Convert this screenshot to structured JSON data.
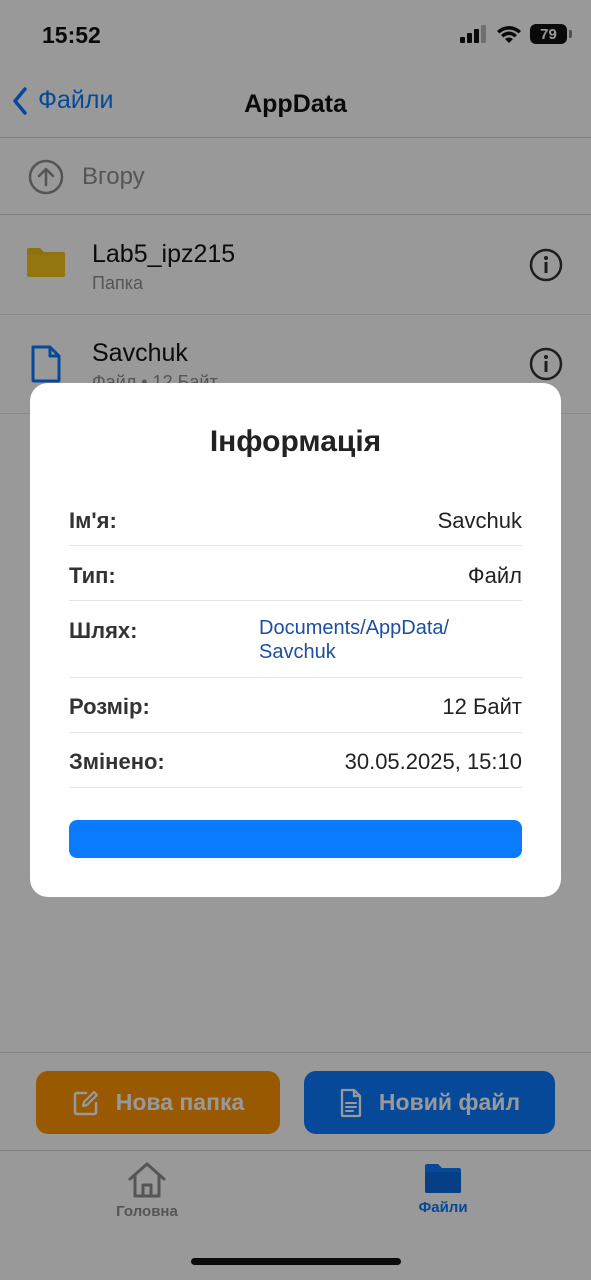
{
  "status": {
    "time": "15:52",
    "battery": "79"
  },
  "nav": {
    "back_label": "Файли",
    "title": "AppData"
  },
  "up_row": {
    "label": "Вгору"
  },
  "files": [
    {
      "name": "Lab5_ipz215",
      "subtitle": "Папка",
      "icon": "folder-icon"
    },
    {
      "name": "Savchuk",
      "subtitle": "Файл • 12 Байт",
      "icon": "document-icon"
    }
  ],
  "actions": {
    "new_folder": "Нова папка",
    "new_file": "Новий файл"
  },
  "tabs": {
    "home": "Головна",
    "files": "Файли"
  },
  "colors": {
    "accent": "#0a7aff",
    "folder": "#ff9500",
    "folder_icon": "#f5c518"
  },
  "modal": {
    "title": "Інформація",
    "rows": [
      {
        "label": "Ім'я:",
        "value": "Savchuk"
      },
      {
        "label": "Тип:",
        "value": "Файл"
      },
      {
        "label": "Шлях:",
        "value_line1": "Documents/AppData/",
        "value_line2": "Savchuk"
      },
      {
        "label": "Розмір:",
        "value": "12 Байт"
      },
      {
        "label": "Змінено:",
        "value": "30.05.2025, 15:10"
      }
    ]
  }
}
